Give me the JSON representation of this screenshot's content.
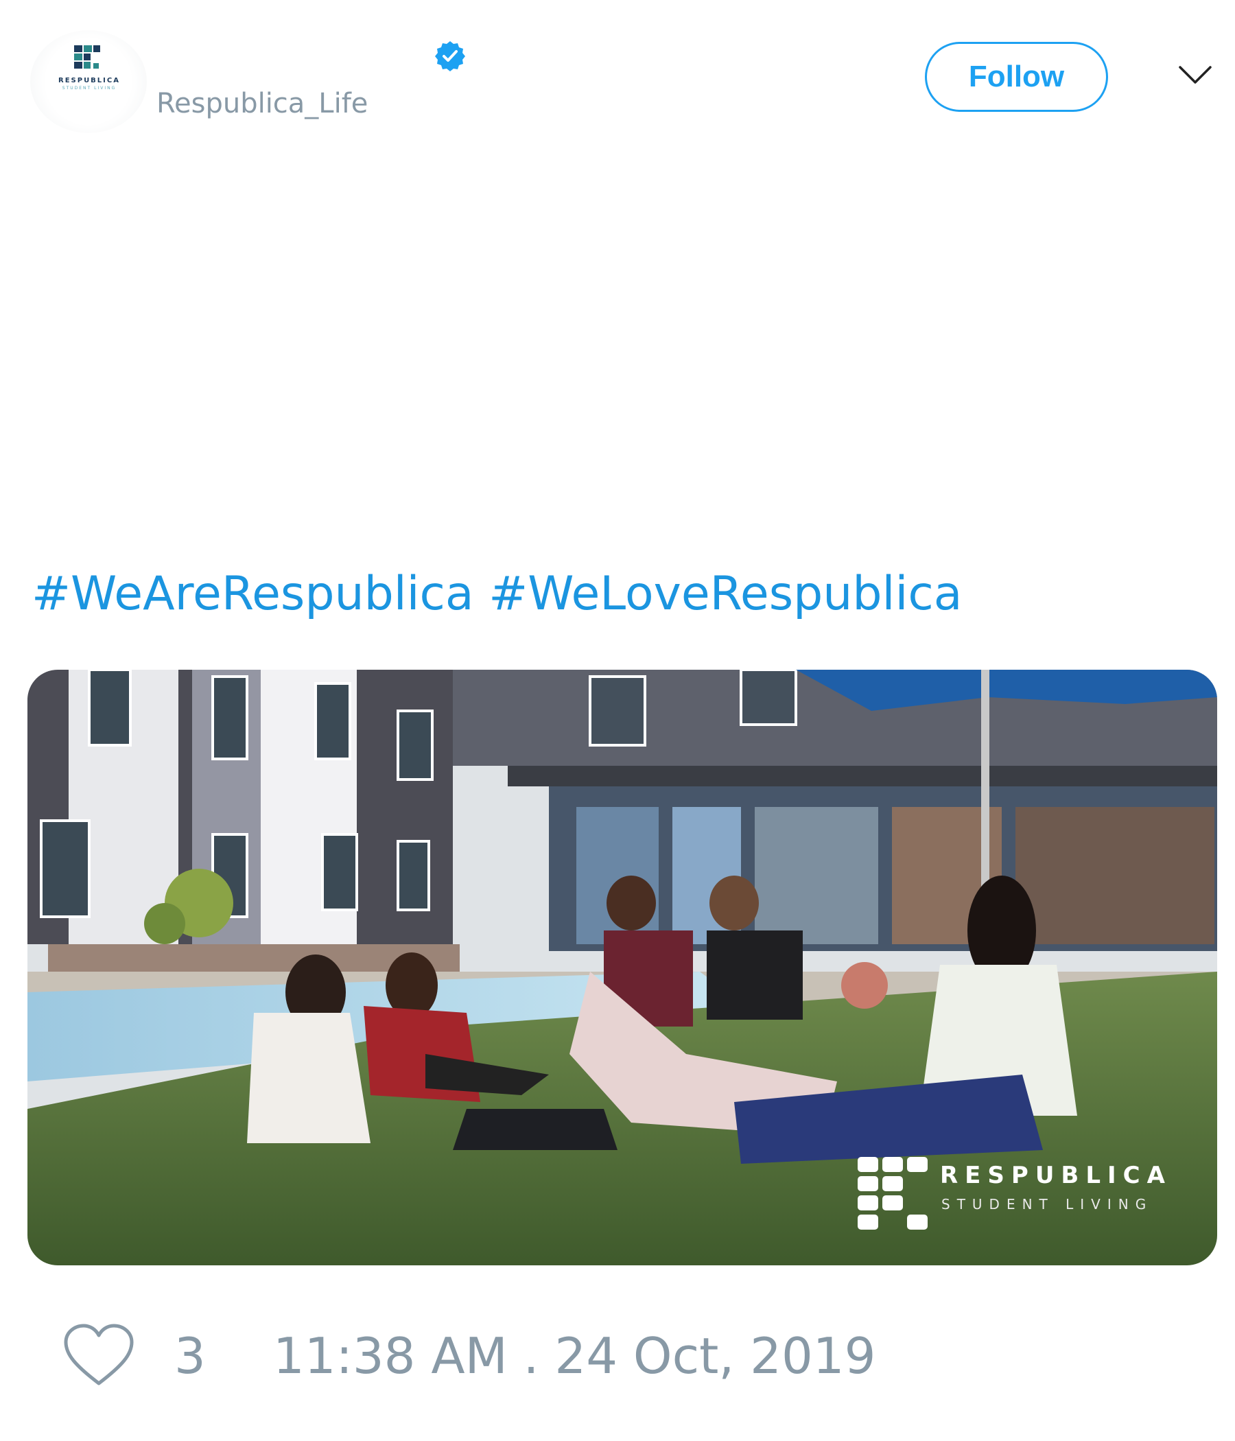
{
  "author": {
    "handle": "Respublica_Life",
    "verified": true,
    "avatar_icon": "respublica-logo",
    "avatar_text": "RESPUBLICA",
    "avatar_subtext": "STUDENT LIVING"
  },
  "header": {
    "follow_label": "Follow",
    "menu_icon": "chevron-down-icon"
  },
  "tweet": {
    "hashtags": [
      "#WeAreRespublica",
      "#WeLoveRespublica"
    ]
  },
  "media": {
    "watermark_title": "RESPUBLICA",
    "watermark_subtitle": "STUDENT LIVING"
  },
  "footer": {
    "like_icon": "heart-icon",
    "like_count": "3",
    "timestamp": "11:38 AM . 24 Oct, 2019"
  },
  "colors": {
    "accent": "#1da1f2",
    "hashtag": "#1b95e0",
    "muted": "#8899a6"
  }
}
